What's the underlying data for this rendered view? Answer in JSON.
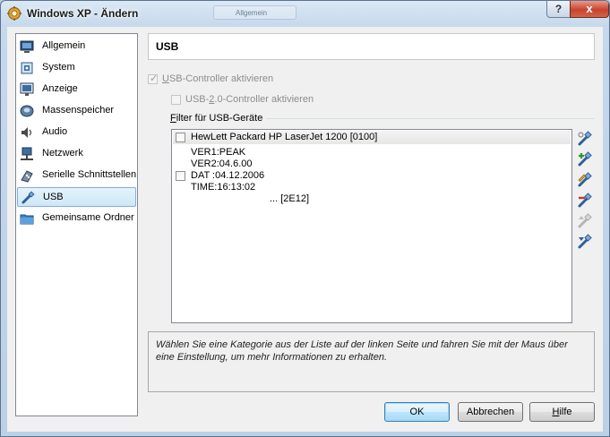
{
  "window": {
    "title": "Windows XP - Ändern",
    "help_label": "?",
    "close_label": "x",
    "background_tab_label": "Allgemein"
  },
  "sidebar": {
    "items": [
      {
        "label": "Allgemein",
        "icon": "monitor-icon",
        "selected": false
      },
      {
        "label": "System",
        "icon": "chip-icon",
        "selected": false
      },
      {
        "label": "Anzeige",
        "icon": "display-icon",
        "selected": false
      },
      {
        "label": "Massenspeicher",
        "icon": "disk-icon",
        "selected": false
      },
      {
        "label": "Audio",
        "icon": "speaker-icon",
        "selected": false
      },
      {
        "label": "Netzwerk",
        "icon": "network-icon",
        "selected": false
      },
      {
        "label": "Serielle Schnittstellen",
        "icon": "serial-port-icon",
        "selected": false
      },
      {
        "label": "USB",
        "icon": "usb-icon",
        "selected": true
      },
      {
        "label": "Gemeinsame Ordner",
        "icon": "folder-icon",
        "selected": false
      }
    ]
  },
  "page": {
    "title": "USB"
  },
  "usb": {
    "controller": {
      "label_u": "U",
      "label_rest": "SB-Controller aktivieren",
      "checked": true,
      "enabled": false
    },
    "usb2": {
      "label_pre": "USB-",
      "label_u": "2",
      "label_rest": ".0-Controller aktivieren",
      "checked": false,
      "enabled": false
    },
    "filter_label_u": "F",
    "filter_label_rest": "ilter für USB-Geräte",
    "devices": [
      {
        "name": "HewLett Packard HP LaserJet 1200 [0100]",
        "checked": false
      }
    ],
    "detail_lines": [
      "VER1:PEAK",
      "VER2:04.6.00"
    ],
    "date_line": "DAT :04.12.2006",
    "time_line": "TIME:16:13:02",
    "more_line": "... [2E12]",
    "toolbar_icons": [
      "usb-filter-new-icon",
      "usb-filter-add-icon",
      "usb-filter-edit-icon",
      "usb-filter-remove-icon",
      "usb-filter-up-icon",
      "usb-filter-down-icon"
    ]
  },
  "info_text": "Wählen Sie eine Kategorie aus der Liste auf der linken Seite und fahren Sie mit der Maus über eine Einstellung, um mehr Informationen zu erhalten.",
  "buttons": {
    "ok": "OK",
    "cancel": "Abbrechen",
    "help_u": "H",
    "help_rest": "ilfe"
  }
}
